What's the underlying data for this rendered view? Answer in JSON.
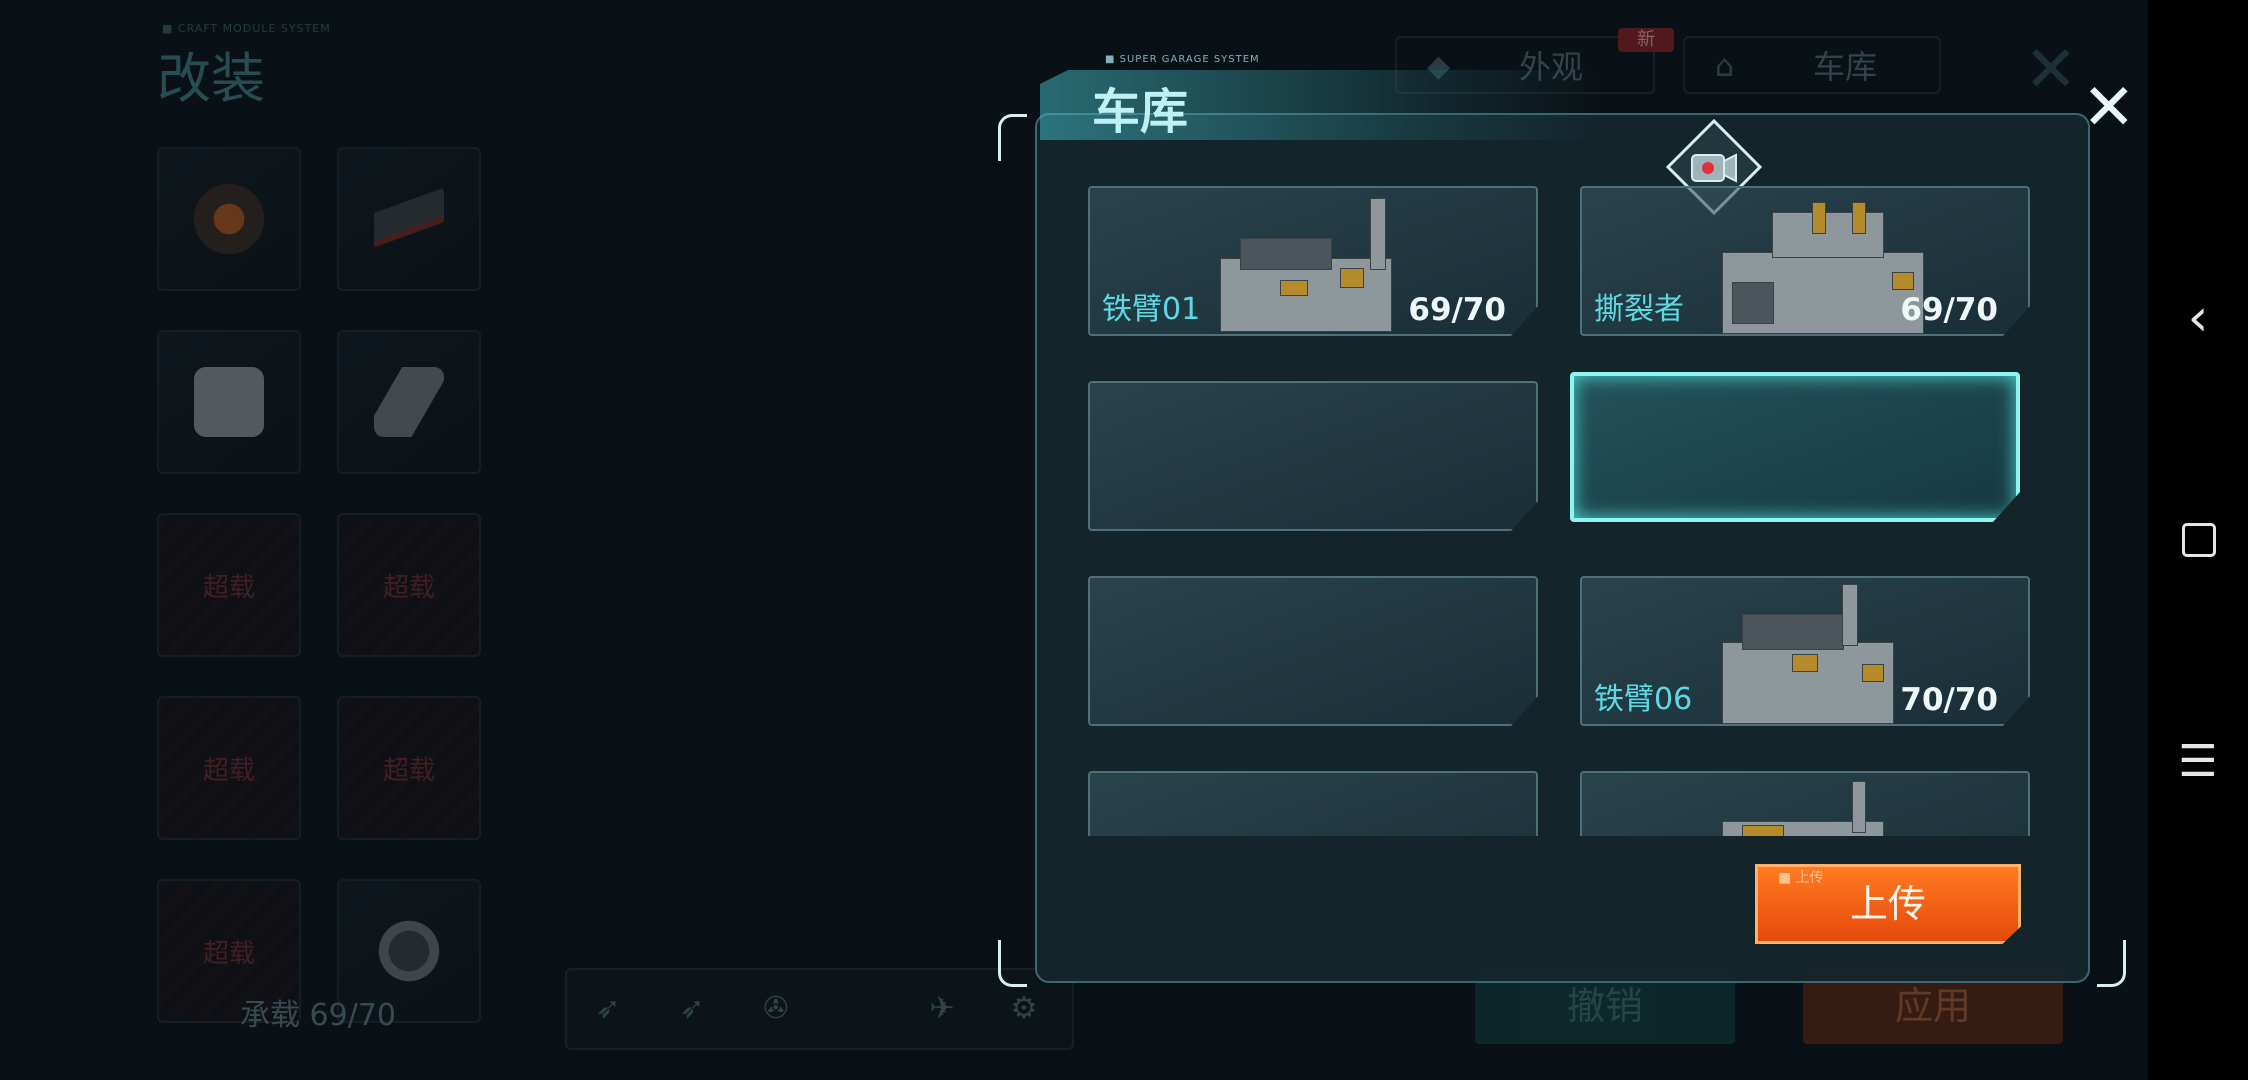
{
  "background": {
    "caption": "■ CRAFT MODULE SYSTEM",
    "title": "改装",
    "slots": [
      {
        "type": "part",
        "icon": "engine-part-icon"
      },
      {
        "type": "part",
        "icon": "cannon-part-icon"
      },
      {
        "type": "part",
        "icon": "armor-cube-icon"
      },
      {
        "type": "part",
        "icon": "claw-part-icon"
      },
      {
        "type": "overload",
        "label": "超载"
      },
      {
        "type": "overload",
        "label": "超载"
      },
      {
        "type": "overload",
        "label": "超载"
      },
      {
        "type": "overload",
        "label": "超载"
      },
      {
        "type": "overload",
        "label": "超载"
      },
      {
        "type": "part",
        "icon": "wheel-part-icon"
      }
    ],
    "capacity": "承载 69/70",
    "tabs": [
      {
        "label": "外观",
        "icon": "appearance-icon",
        "badge": "新"
      },
      {
        "label": "车库",
        "icon": "garage-icon"
      }
    ],
    "buttons": {
      "undo": "撤销",
      "apply": "应用"
    },
    "toolbar_icons": [
      "missile-icon",
      "rocket-icon",
      "drone-icon",
      "satellite-icon",
      "gear-icon"
    ]
  },
  "garage": {
    "caption": "■ SUPER GARAGE SYSTEM",
    "title": "车库",
    "camera_icon": "camera-icon",
    "close_icon": "close-icon",
    "cards": [
      {
        "name": "铁臂01",
        "load": "69/70",
        "filled": true,
        "selected": false
      },
      {
        "name": "撕裂者",
        "load": "69/70",
        "filled": true,
        "selected": false
      },
      {
        "name": "",
        "load": "",
        "filled": false,
        "selected": false
      },
      {
        "name": "",
        "load": "",
        "filled": false,
        "selected": true
      },
      {
        "name": "",
        "load": "",
        "filled": false,
        "selected": false
      },
      {
        "name": "铁臂06",
        "load": "70/70",
        "filled": true,
        "selected": false
      },
      {
        "name": "",
        "load": "",
        "filled": false,
        "selected": false
      },
      {
        "name": "",
        "load": "",
        "filled": true,
        "selected": false
      }
    ],
    "upload_caption": "■ 上传",
    "upload_label": "上传"
  },
  "system_nav": [
    "back-icon",
    "home-icon",
    "menu-icon"
  ],
  "colors": {
    "accent": "#5ed9e3",
    "upload": "#ff6a1a",
    "selected": "#8ff5ef"
  }
}
